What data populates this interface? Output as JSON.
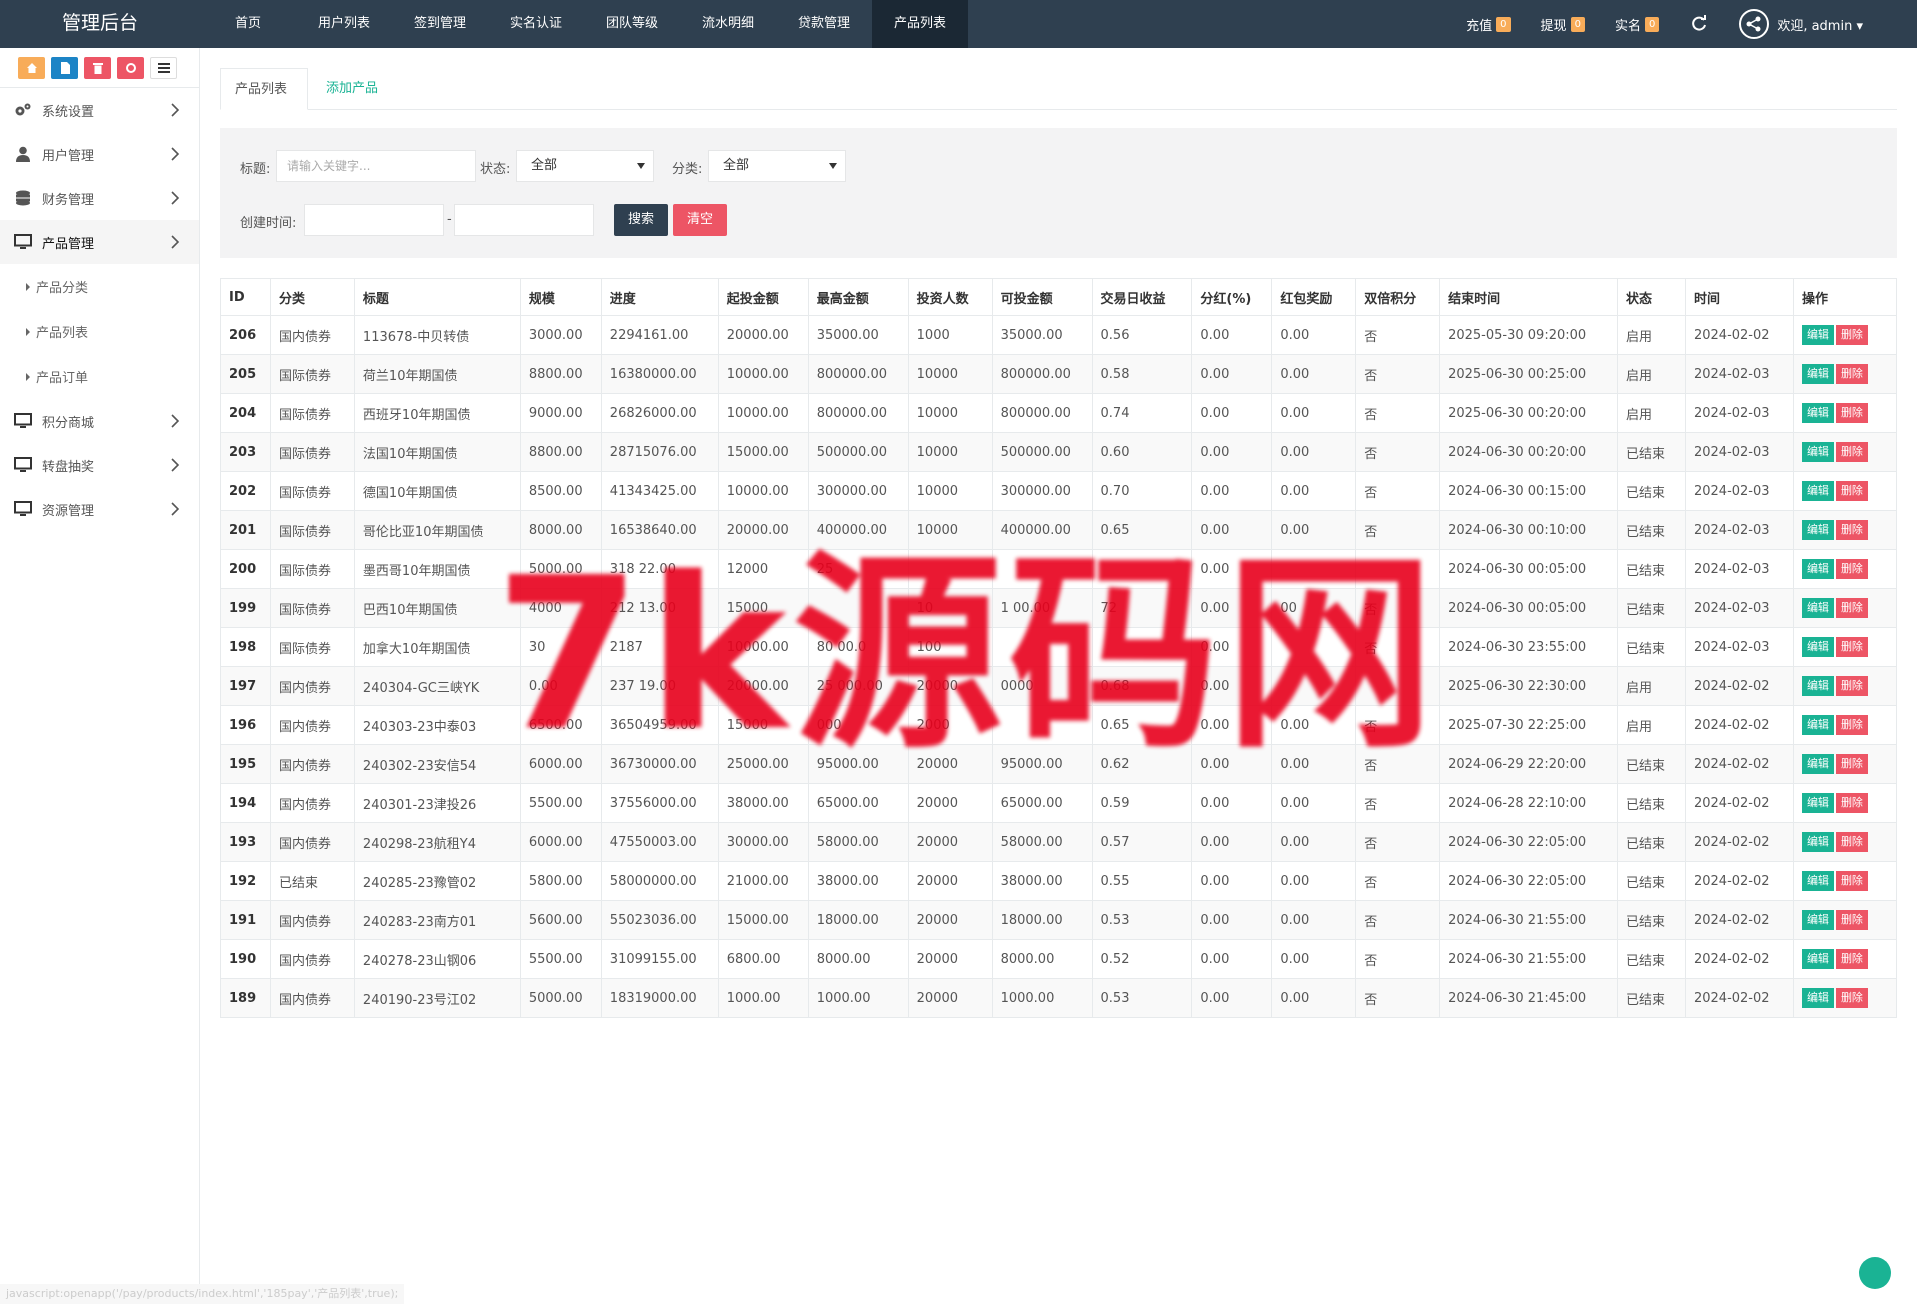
{
  "brand": "管理后台",
  "topnav": [
    "首页",
    "用户列表",
    "签到管理",
    "实名认证",
    "团队等级",
    "流水明细",
    "贷款管理",
    "产品列表"
  ],
  "topnav_active": 7,
  "stats": [
    {
      "label": "充值",
      "count": "0"
    },
    {
      "label": "提现",
      "count": "0"
    },
    {
      "label": "实名",
      "count": "0"
    }
  ],
  "welcome": "欢迎, admin",
  "sidebar": {
    "menu": [
      {
        "label": "系统设置",
        "icon": "gears-icon"
      },
      {
        "label": "用户管理",
        "icon": "user-icon"
      },
      {
        "label": "财务管理",
        "icon": "database-icon"
      },
      {
        "label": "产品管理",
        "icon": "monitor-icon"
      }
    ],
    "submenu": [
      "产品分类",
      "产品列表",
      "产品订单"
    ],
    "menu2": [
      {
        "label": "积分商城",
        "icon": "monitor-icon"
      },
      {
        "label": "转盘抽奖",
        "icon": "monitor-icon"
      },
      {
        "label": "资源管理",
        "icon": "monitor-icon"
      }
    ]
  },
  "tabs": {
    "active": "产品列表",
    "add": "添加产品"
  },
  "filter": {
    "title_label": "标题:",
    "title_placeholder": "请输入关键字...",
    "status_label": "状态:",
    "status_value": "全部",
    "category_label": "分类:",
    "category_value": "全部",
    "created_label": "创建时间:",
    "dash": "-",
    "search_btn": "搜索",
    "clear_btn": "清空"
  },
  "table": {
    "headers": [
      "ID",
      "分类",
      "标题",
      "规模",
      "进度",
      "起投金额",
      "最高金额",
      "投资人数",
      "可投金额",
      "交易日收益",
      "分红(%)",
      "红包奖励",
      "双倍积分",
      "结束时间",
      "状态",
      "时间",
      "操作"
    ],
    "edit_label": "编辑",
    "delete_label": "删除",
    "rows": [
      [
        "206",
        "国内债券",
        "113678-中贝转债",
        "3000.00",
        "2294161.00",
        "20000.00",
        "35000.00",
        "1000",
        "35000.00",
        "0.56",
        "0.00",
        "0.00",
        "否",
        "2025-05-30 09:20:00",
        "启用",
        "2024-02-02"
      ],
      [
        "205",
        "国际债券",
        "荷兰10年期国债",
        "8800.00",
        "16380000.00",
        "10000.00",
        "800000.00",
        "10000",
        "800000.00",
        "0.58",
        "0.00",
        "0.00",
        "否",
        "2025-06-30 00:25:00",
        "启用",
        "2024-02-03"
      ],
      [
        "204",
        "国际债券",
        "西班牙10年期国债",
        "9000.00",
        "26826000.00",
        "10000.00",
        "800000.00",
        "10000",
        "800000.00",
        "0.74",
        "0.00",
        "0.00",
        "否",
        "2025-06-30 00:20:00",
        "启用",
        "2024-02-03"
      ],
      [
        "203",
        "国际债券",
        "法国10年期国债",
        "8800.00",
        "28715076.00",
        "15000.00",
        "500000.00",
        "10000",
        "500000.00",
        "0.60",
        "0.00",
        "0.00",
        "否",
        "2024-06-30 00:20:00",
        "已结束",
        "2024-02-03"
      ],
      [
        "202",
        "国际债券",
        "德国10年期国债",
        "8500.00",
        "41343425.00",
        "10000.00",
        "300000.00",
        "10000",
        "300000.00",
        "0.70",
        "0.00",
        "0.00",
        "否",
        "2024-06-30 00:15:00",
        "已结束",
        "2024-02-03"
      ],
      [
        "201",
        "国际债券",
        "哥伦比亚10年期国债",
        "8000.00",
        "16538640.00",
        "20000.00",
        "400000.00",
        "10000",
        "400000.00",
        "0.65",
        "0.00",
        "0.00",
        "否",
        "2024-06-30 00:10:00",
        "已结束",
        "2024-02-03"
      ],
      [
        "200",
        "国际债券",
        "墨西哥10年期国债",
        "5000.00",
        "318  22.00",
        "12000",
        "25",
        "",
        "",
        "",
        "0.00",
        "",
        "",
        "2024-06-30 00:05:00",
        "已结束",
        "2024-02-03"
      ],
      [
        "199",
        "国际债券",
        "巴西10年期国债",
        "4000",
        "212  13.00",
        "15000",
        "",
        "10",
        "1  00.00",
        "72",
        "0.00",
        "00",
        "否",
        "2024-06-30 00:05:00",
        "已结束",
        "2024-02-03"
      ],
      [
        "198",
        "国际债券",
        "加拿大10年期国债",
        "30",
        "2187",
        "10000.00",
        "80  00.0",
        "100",
        "",
        "",
        "0.00",
        "",
        "否",
        "2024-06-30 23:55:00",
        "已结束",
        "2024-02-03"
      ],
      [
        "197",
        "国内债券",
        "240304-GC三峡YK",
        "0.00",
        "237  19.00",
        "20000.00",
        "25  000.00",
        "20000",
        "  0000",
        "0.68",
        "0.00",
        "",
        "",
        "2025-06-30 22:30:00",
        "启用",
        "2024-02-02"
      ],
      [
        "196",
        "国内债券",
        "240303-23中泰03",
        "6500.00",
        "36504959.00",
        "15000",
        "000",
        "2000",
        "",
        "0.65",
        "0.00",
        "0.00",
        "否",
        "2025-07-30 22:25:00",
        "启用",
        "2024-02-02"
      ],
      [
        "195",
        "国内债券",
        "240302-23安信54",
        "6000.00",
        "36730000.00",
        "25000.00",
        "95000.00",
        "20000",
        "95000.00",
        "0.62",
        "0.00",
        "0.00",
        "否",
        "2024-06-29 22:20:00",
        "已结束",
        "2024-02-02"
      ],
      [
        "194",
        "国内债券",
        "240301-23津投26",
        "5500.00",
        "37556000.00",
        "38000.00",
        "65000.00",
        "20000",
        "65000.00",
        "0.59",
        "0.00",
        "0.00",
        "否",
        "2024-06-28 22:10:00",
        "已结束",
        "2024-02-02"
      ],
      [
        "193",
        "国内债券",
        "240298-23航租Y4",
        "6000.00",
        "47550003.00",
        "30000.00",
        "58000.00",
        "20000",
        "58000.00",
        "0.57",
        "0.00",
        "0.00",
        "否",
        "2024-06-30 22:05:00",
        "已结束",
        "2024-02-02"
      ],
      [
        "192",
        "已结束",
        "240285-23豫管02",
        "5800.00",
        "58000000.00",
        "21000.00",
        "38000.00",
        "20000",
        "38000.00",
        "0.55",
        "0.00",
        "0.00",
        "否",
        "2024-06-30 22:05:00",
        "已结束",
        "2024-02-02"
      ],
      [
        "191",
        "国内债券",
        "240283-23南方01",
        "5600.00",
        "55023036.00",
        "15000.00",
        "18000.00",
        "20000",
        "18000.00",
        "0.53",
        "0.00",
        "0.00",
        "否",
        "2024-06-30 21:55:00",
        "已结束",
        "2024-02-02"
      ],
      [
        "190",
        "国内债券",
        "240278-23山钢06",
        "5500.00",
        "31099155.00",
        "6800.00",
        "8000.00",
        "20000",
        "8000.00",
        "0.52",
        "0.00",
        "0.00",
        "否",
        "2024-06-30 21:55:00",
        "已结束",
        "2024-02-02"
      ],
      [
        "189",
        "国内债券",
        "240190-23号江02",
        "5000.00",
        "18319000.00",
        "1000.00",
        "1000.00",
        "20000",
        "1000.00",
        "0.53",
        "0.00",
        "0.00",
        "否",
        "2024-06-30 21:45:00",
        "已结束",
        "2024-02-02"
      ]
    ]
  },
  "watermark": "7k源码网",
  "statusbar": "javascript:openapp('/pay/products/index.html','185pay','产品列表',true);",
  "colors": {
    "topbar": "#2f4050",
    "green": "#1ab394",
    "red": "#ed5565",
    "orange": "#f8ac59",
    "blue": "#1c84c6"
  }
}
